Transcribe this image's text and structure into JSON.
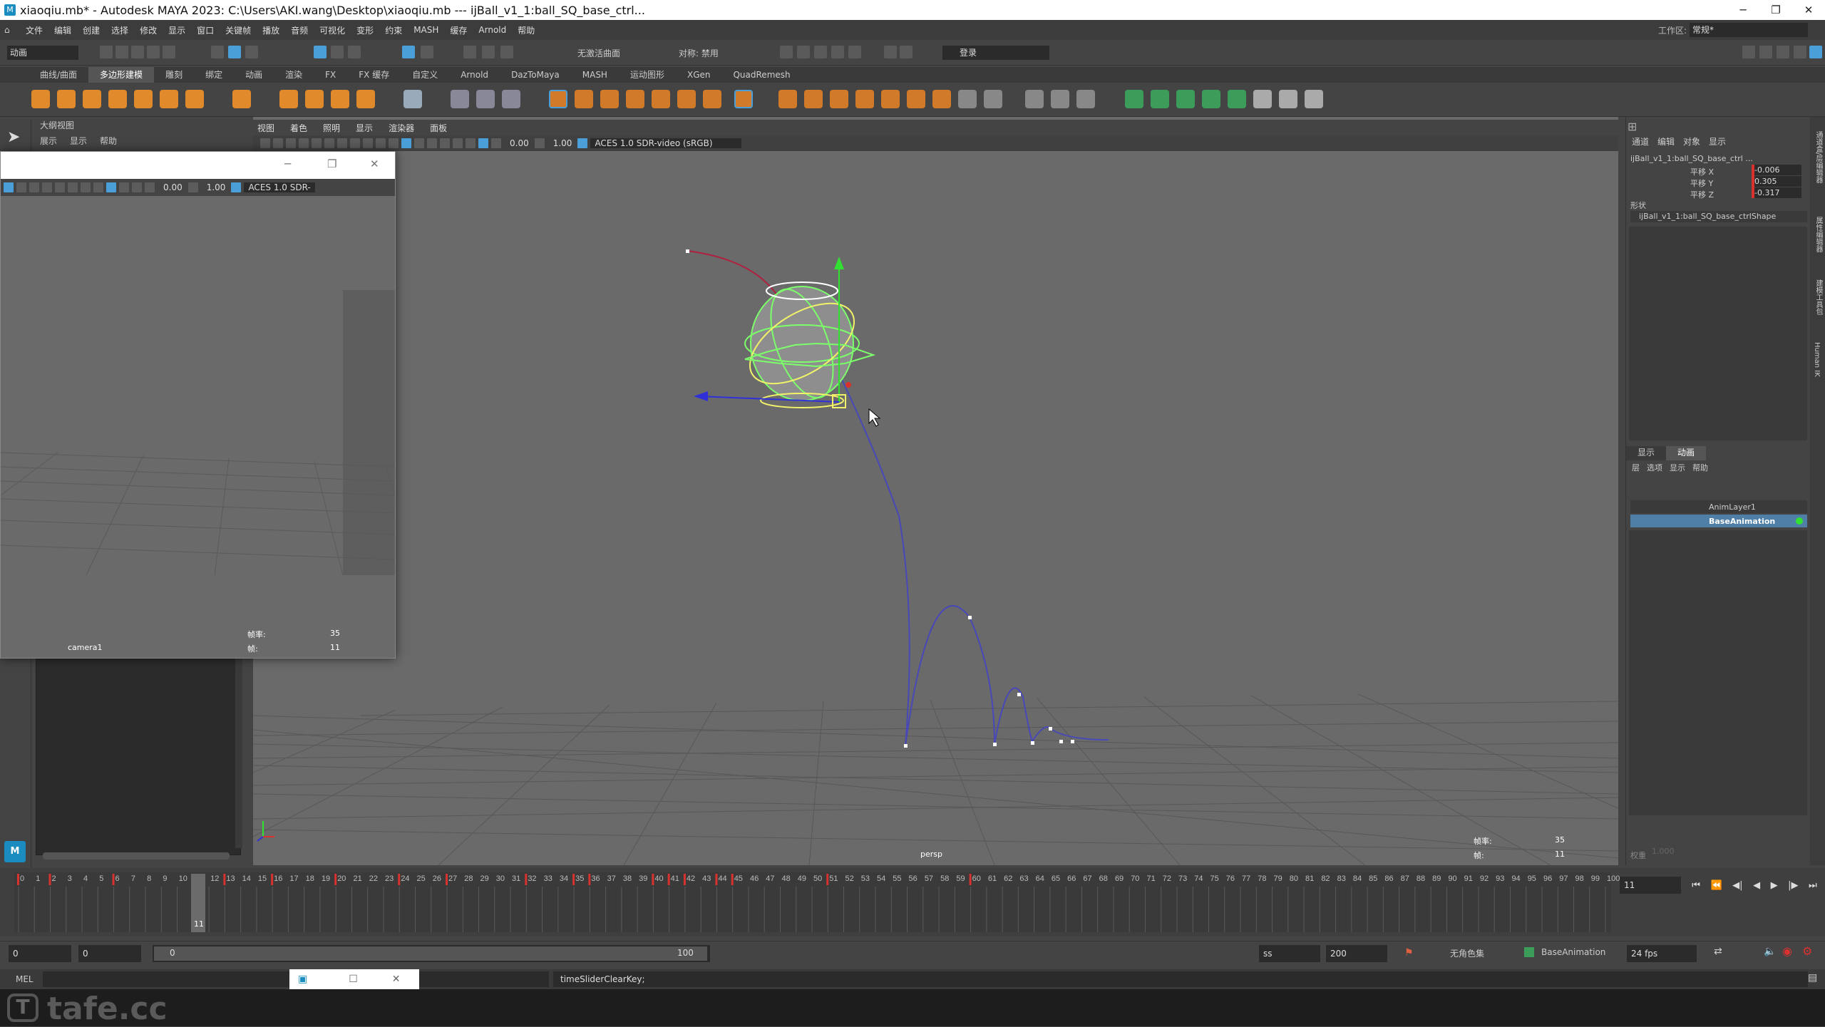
{
  "window": {
    "title": "xiaoqiu.mb* - Autodesk MAYA 2023: C:\\Users\\AKI.wang\\Desktop\\xiaoqiu.mb  ---  ijBall_v1_1:ball_SQ_base_ctrl...",
    "minimize": "─",
    "maximize": "❐",
    "close": "✕"
  },
  "menus": [
    "文件",
    "编辑",
    "创建",
    "选择",
    "修改",
    "显示",
    "窗口",
    "关键帧",
    "播放",
    "音频",
    "可视化",
    "变形",
    "约束",
    "MASH",
    "缓存",
    "Arnold",
    "帮助"
  ],
  "status": {
    "mode": "动画",
    "live_surface": "无激活曲面",
    "symmetry": "对称: 禁用",
    "login": "登录",
    "workspace_label": "工作区:",
    "workspace_value": "常规*"
  },
  "shelf_tabs": [
    "曲线/曲面",
    "多边形建模",
    "雕刻",
    "绑定",
    "动画",
    "渲染",
    "FX",
    "FX 缓存",
    "自定义",
    "Arnold",
    "DazToMaya",
    "MASH",
    "运动图形",
    "XGen",
    "QuadRemesh"
  ],
  "shelf_active": "多边形建模",
  "outliner": {
    "title": "大纲视图",
    "menu": [
      "展示",
      "显示",
      "帮助"
    ]
  },
  "viewport": {
    "menu": [
      "视图",
      "着色",
      "照明",
      "显示",
      "渲染器",
      "面板"
    ],
    "field_a": "0.00",
    "field_b": "1.00",
    "color_space": "ACES 1.0 SDR-video (sRGB)",
    "camera": "persp",
    "hud_frames_label": "帧率:",
    "hud_frames_value": "35",
    "hud_frame_label": "帧:",
    "hud_frame_value": "11"
  },
  "float_window": {
    "field_a": "0.00",
    "field_b": "1.00",
    "color_space": "ACES 1.0 SDR-",
    "camera": "camera1",
    "hud_frames_label": "帧率:",
    "hud_frames_value": "35",
    "hud_frame_label": "帧:",
    "hud_frame_value": "11"
  },
  "channel_box": {
    "menu": [
      "通道",
      "编辑",
      "对象",
      "显示"
    ],
    "object": "ijBall_v1_1:ball_SQ_base_ctrl ...",
    "channels": [
      {
        "name": "平移 X",
        "value": "-0.006"
      },
      {
        "name": "平移 Y",
        "value": "0.305"
      },
      {
        "name": "平移 Z",
        "value": "-0.317"
      }
    ],
    "shapes_label": "形状",
    "shape_name": "ijBall_v1_1:ball_SQ_base_ctrlShape"
  },
  "layer_editor": {
    "tabs": [
      "显示",
      "动画"
    ],
    "menu": [
      "层",
      "选项",
      "显示",
      "帮助"
    ],
    "layers": [
      "AnimLayer1",
      "BaseAnimation"
    ],
    "weight_label": "权重",
    "weight_value": "1.000"
  },
  "side_tabs": [
    "通道盒/层编辑器",
    "属性编辑器",
    "建模工具包",
    "Human IK"
  ],
  "timeline": {
    "start": 0,
    "end": 100,
    "current_frame": "11",
    "current_frame_field": "11"
  },
  "range": {
    "start_a": "0",
    "start_b": "0",
    "inner_start": "0",
    "inner_end": "100",
    "end_a": "ss",
    "end_b": "200",
    "char_set": "无角色集",
    "anim_layer": "BaseAnimation",
    "fps": "24 fps"
  },
  "command": {
    "lang": "MEL",
    "result": "timeSliderClearKey;"
  },
  "watermark": "tafe.cc",
  "colors": {
    "accent": "#4a9fd8",
    "selected_layer": "#4f7fa6",
    "key_red": "#d9312e",
    "motion_path": "#4848b8",
    "ctrl_green": "#7cff6b",
    "ctrl_yellow": "#f2f26a"
  }
}
